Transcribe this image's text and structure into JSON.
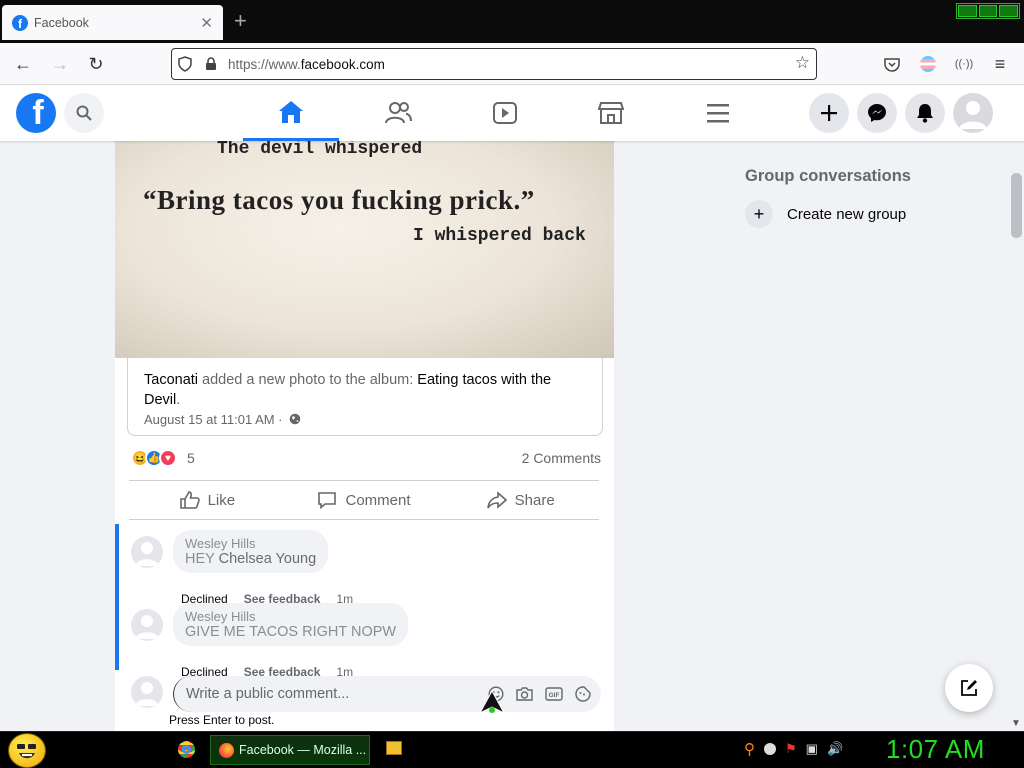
{
  "browser": {
    "tab_title": "Facebook",
    "url_prefix": "https://www.",
    "url_host": "facebook.com"
  },
  "post": {
    "photo_lines": [
      "The devil whispered",
      "“Bring tacos you fucking prick.”",
      "I whispered back"
    ],
    "attach_actor": "Taconati",
    "attach_mid": " added a new photo to the album: ",
    "attach_album": "Eating tacos with the Devil",
    "attach_end": ".",
    "date": "August 15 at 11:01 AM ·",
    "reaction_count": "5",
    "comments_count": "2 Comments",
    "actions": {
      "like": "Like",
      "comment": "Comment",
      "share": "Share"
    }
  },
  "comments": [
    {
      "author": "Wesley Hills",
      "text_pre": "HEY ",
      "mention": "Chelsea Young",
      "status": "Declined",
      "feedback": "See feedback",
      "time": "1m"
    },
    {
      "author": "Wesley Hills",
      "text_pre": "GIVE ME TACOS RIGHT NOPW",
      "mention": "",
      "status": "Declined",
      "feedback": "See feedback",
      "time": "1m"
    }
  ],
  "composer": {
    "placeholder": "Write a public comment...",
    "hint": "Press Enter to post."
  },
  "sidebar": {
    "group_title": "Group conversations",
    "create_group": "Create new group"
  },
  "taskbar": {
    "task_label": "Facebook — Mozilla ...",
    "clock": "1:07 AM"
  },
  "colors": {
    "fb_blue": "#1877f2",
    "clock_green": "#22dd22"
  }
}
